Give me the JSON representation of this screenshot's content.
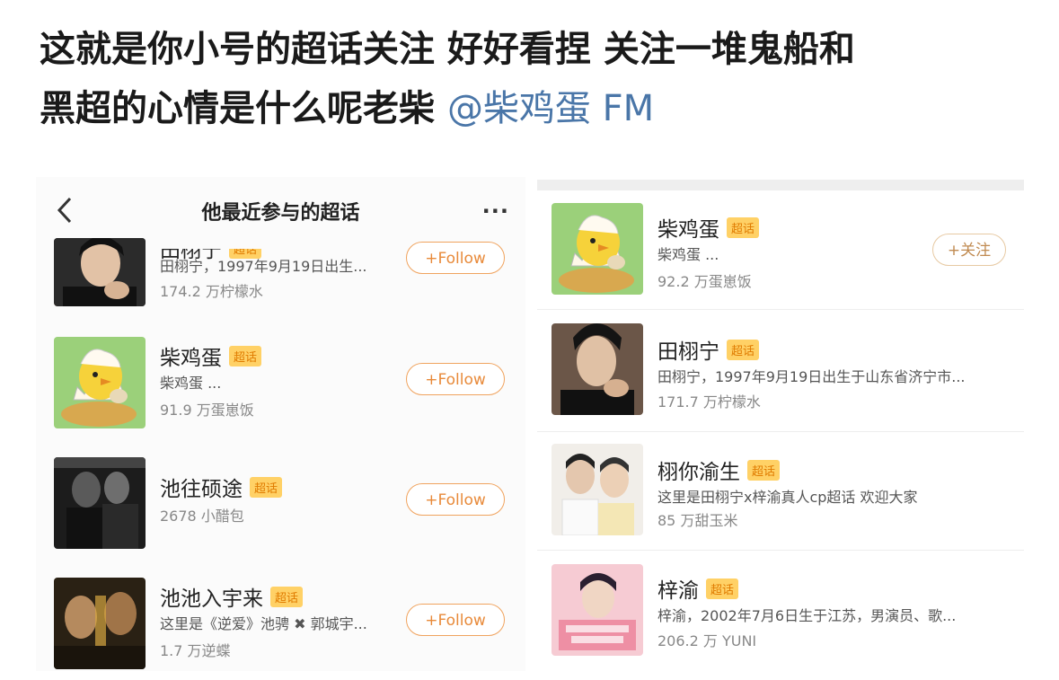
{
  "caption": {
    "line1": "这就是你小号的超话关注 好好看捏 关注一堆鬼船和",
    "line2": "黑超的心情是什么呢老柴",
    "mention": "@柴鸡蛋 FM"
  },
  "left_panel": {
    "title": "他最近参与的超话",
    "more": "···",
    "items": [
      {
        "name": "田栩宁",
        "badge": "超话",
        "desc": "田栩宁，1997年9月19日出生...",
        "fans": "174.2 万柠檬水",
        "button": "+Follow",
        "image": "portrait-photo"
      },
      {
        "name": "柴鸡蛋",
        "badge": "超话",
        "desc": "柴鸡蛋 ...",
        "fans": "91.9 万蛋崽饭",
        "button": "+Follow",
        "image": "chick-cartoon"
      },
      {
        "name": "池往硕途",
        "badge": "超话",
        "desc": "",
        "fans": "2678 小醋包",
        "button": "+Follow",
        "image": "dark-photo"
      },
      {
        "name": "池池入宇来",
        "badge": "超话",
        "desc": "这里是《逆爱》池骋 ✖ 郭城宇...",
        "fans": "1.7 万逆蝶",
        "button": "+Follow",
        "image": "warm-photo"
      }
    ]
  },
  "right_panel": {
    "items": [
      {
        "name": "柴鸡蛋",
        "badge": "超话",
        "desc": "柴鸡蛋 ...",
        "fans": "92.2 万蛋崽饭",
        "button": "+关注",
        "image": "chick-cartoon"
      },
      {
        "name": "田栩宁",
        "badge": "超话",
        "desc": "田栩宁，1997年9月19日出生于山东省济宁市...",
        "fans": "171.7 万柠檬水",
        "button": "",
        "image": "portrait-photo"
      },
      {
        "name": "栩你渝生",
        "badge": "超话",
        "desc": "这里是田栩宁x梓渝真人cp超话 欢迎大家",
        "fans": "85 万甜玉米",
        "button": "",
        "image": "duo-photo"
      },
      {
        "name": "梓渝",
        "badge": "超话",
        "desc": "梓渝，2002年7月6日生于江苏，男演员、歌...",
        "fans": "206.2 万 YUNI",
        "button": "",
        "image": "pink-photo"
      }
    ]
  }
}
